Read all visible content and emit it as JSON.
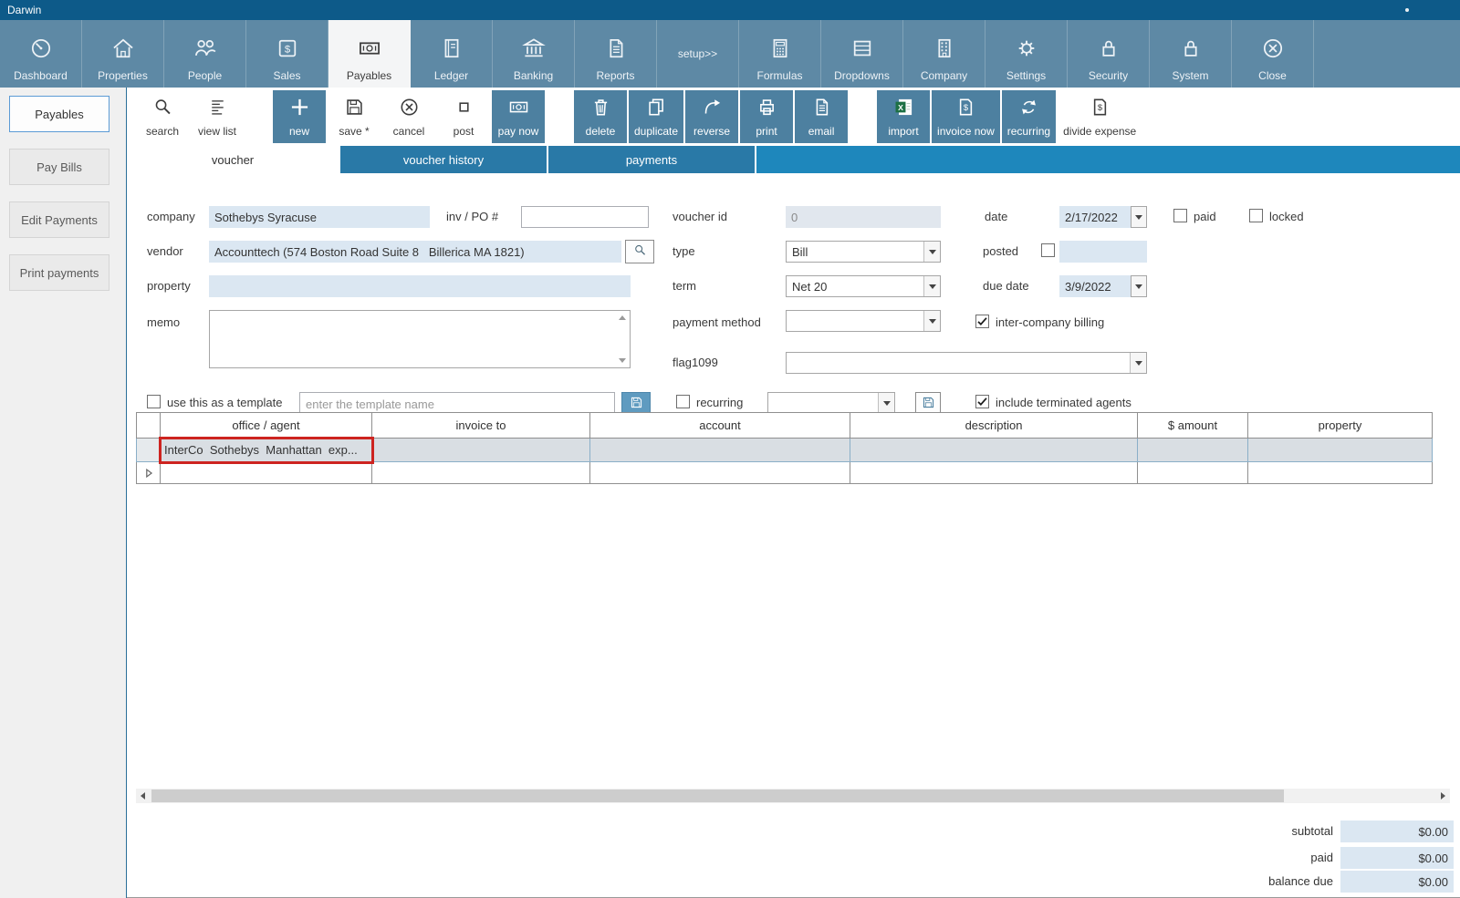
{
  "window": {
    "title": "Darwin"
  },
  "ribbon": {
    "items": [
      {
        "label": "Dashboard"
      },
      {
        "label": "Properties"
      },
      {
        "label": "People"
      },
      {
        "label": "Sales"
      },
      {
        "label": "Payables"
      },
      {
        "label": "Ledger"
      },
      {
        "label": "Banking"
      },
      {
        "label": "Reports"
      },
      {
        "label": "setup>>"
      },
      {
        "label": "Formulas"
      },
      {
        "label": "Dropdowns"
      },
      {
        "label": "Company"
      },
      {
        "label": "Settings"
      },
      {
        "label": "Security"
      },
      {
        "label": "System"
      },
      {
        "label": "Close"
      }
    ]
  },
  "sidebar": {
    "items": [
      {
        "label": "Payables"
      },
      {
        "label": "Pay Bills"
      },
      {
        "label": "Edit Payments"
      },
      {
        "label": "Print payments"
      }
    ]
  },
  "toolbar": {
    "search": "search",
    "view_list": "view list",
    "new": "new",
    "save": "save *",
    "cancel": "cancel",
    "post": "post",
    "pay_now": "pay now",
    "delete": "delete",
    "duplicate": "duplicate",
    "reverse": "reverse",
    "print": "print",
    "email": "email",
    "import": "import",
    "invoice_now": "invoice now",
    "recurring": "recurring",
    "divide_expense": "divide expense"
  },
  "tabs": [
    {
      "label": "voucher"
    },
    {
      "label": "voucher history"
    },
    {
      "label": "payments"
    }
  ],
  "form": {
    "company": {
      "label": "company",
      "value": "Sothebys Syracuse"
    },
    "inv_po": {
      "label": "inv / PO #",
      "value": ""
    },
    "voucher_id": {
      "label": "voucher id",
      "value": "0"
    },
    "date": {
      "label": "date",
      "value": "2/17/2022"
    },
    "paid": {
      "label": "paid",
      "checked": false
    },
    "locked": {
      "label": "locked",
      "checked": false
    },
    "vendor": {
      "label": "vendor",
      "value": "Accounttech (574 Boston Road Suite 8   Billerica MA 1821)"
    },
    "type": {
      "label": "type",
      "value": "Bill"
    },
    "posted": {
      "label": "posted",
      "checked": false
    },
    "property": {
      "label": "property",
      "value": ""
    },
    "term": {
      "label": "term",
      "value": "Net 20"
    },
    "due_date": {
      "label": "due date",
      "value": "3/9/2022"
    },
    "memo": {
      "label": "memo",
      "value": ""
    },
    "payment_method": {
      "label": "payment method",
      "value": ""
    },
    "inter_company_billing": {
      "label": "inter-company billing",
      "checked": true
    },
    "flag1099": {
      "label": "flag1099",
      "value": ""
    },
    "template": {
      "label": "use this as a template",
      "placeholder": "enter the template name",
      "value": "",
      "checked": false
    },
    "recurring": {
      "label": "recurring",
      "value": "",
      "checked": false
    },
    "include_terminated": {
      "label": "include terminated agents",
      "checked": true
    }
  },
  "grid": {
    "columns": [
      "office / agent",
      "invoice to",
      "account",
      "description",
      "$ amount",
      "property"
    ],
    "rows": [
      {
        "office_agent": "InterCo  Sothebys  Manhattan  exp...",
        "invoice_to": "",
        "account": "",
        "description": "",
        "amount": "",
        "property": ""
      }
    ]
  },
  "totals": {
    "subtotal_label": "subtotal",
    "subtotal_value": "$0.00",
    "paid_label": "paid",
    "paid_value": "$0.00",
    "balance_label": "balance due",
    "balance_value": "$0.00"
  }
}
